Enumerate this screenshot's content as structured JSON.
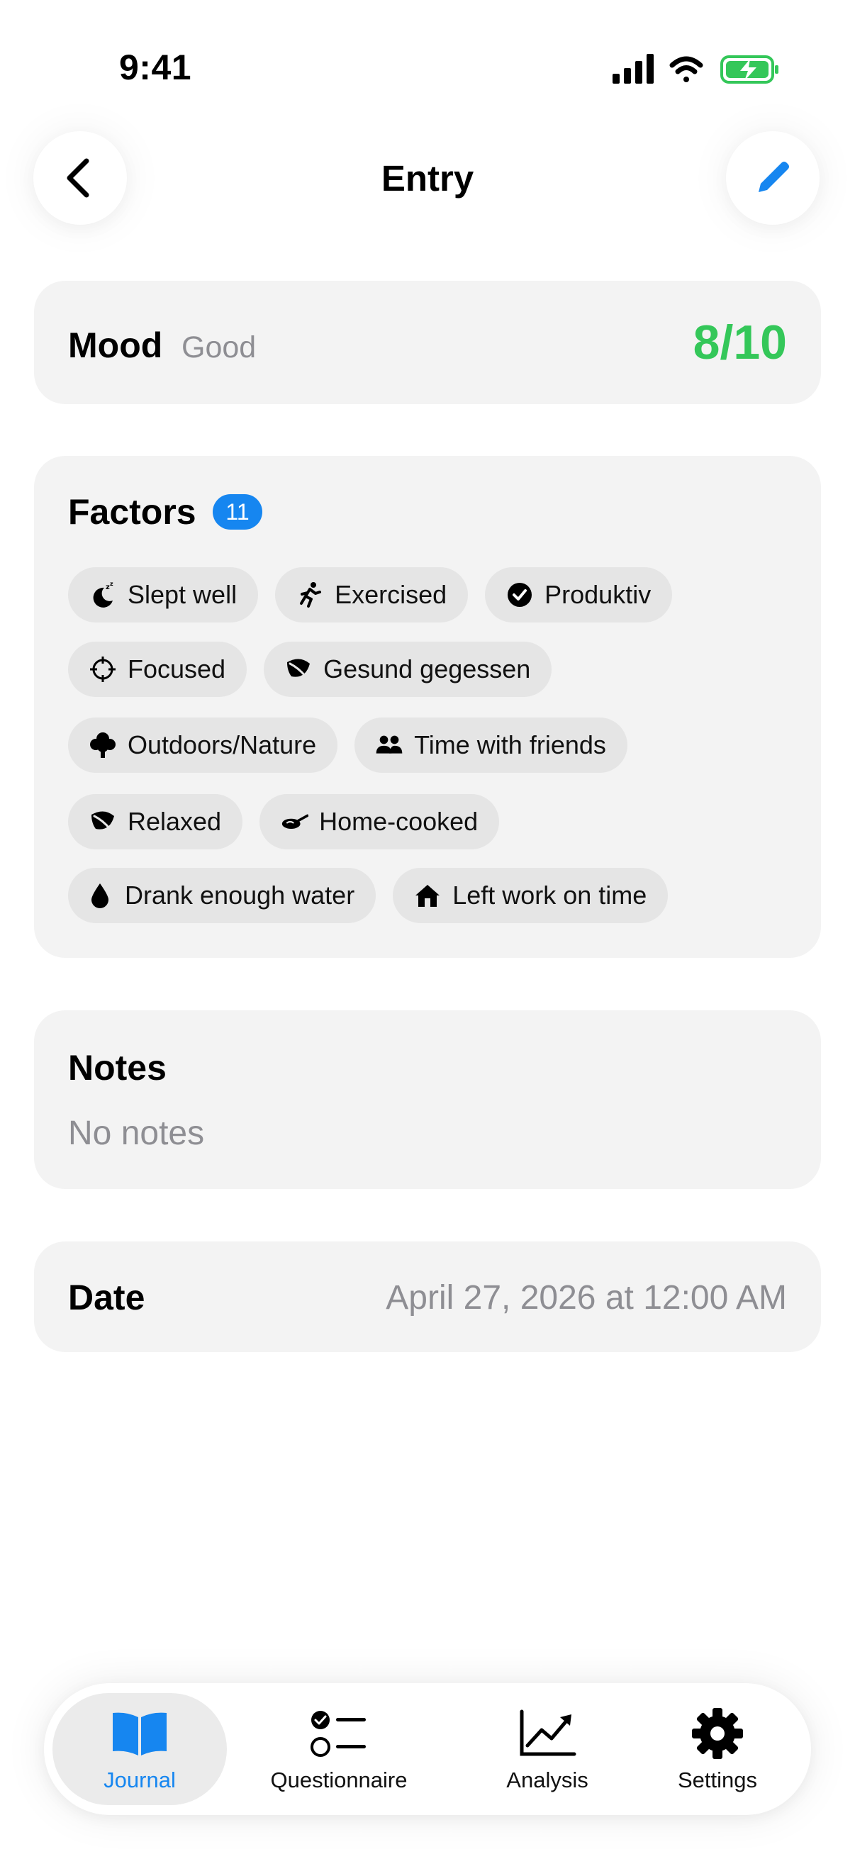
{
  "status_bar": {
    "time": "9:41"
  },
  "header": {
    "title": "Entry"
  },
  "mood": {
    "label": "Mood",
    "word": "Good",
    "score": "8/10"
  },
  "factors": {
    "title": "Factors",
    "count": "11",
    "chips": [
      {
        "label": "Slept well",
        "icon": "moon-zzz-icon"
      },
      {
        "label": "Exercised",
        "icon": "running-figure-icon"
      },
      {
        "label": "Produktiv",
        "icon": "checkmark-circle-icon"
      },
      {
        "label": "Focused",
        "icon": "scope-icon"
      },
      {
        "label": "Gesund gegessen",
        "icon": "leaf-icon"
      },
      {
        "label": "Outdoors/Nature",
        "icon": "tree-icon"
      },
      {
        "label": "Time with friends",
        "icon": "people-icon"
      },
      {
        "label": "Relaxed",
        "icon": "leaf-icon"
      },
      {
        "label": "Home-cooked",
        "icon": "frying-pan-icon"
      },
      {
        "label": "Drank enough water",
        "icon": "drop-icon"
      },
      {
        "label": "Left work on time",
        "icon": "house-icon"
      }
    ]
  },
  "notes": {
    "title": "Notes",
    "empty_text": "No notes"
  },
  "date": {
    "label": "Date",
    "value": "April 27, 2026 at 12:00 AM"
  },
  "tabbar": {
    "active": "Journal",
    "tabs": [
      {
        "label": "Journal",
        "icon": "book-icon"
      },
      {
        "label": "Questionnaire",
        "icon": "checklist-icon"
      },
      {
        "label": "Analysis",
        "icon": "chart-line-up-icon"
      },
      {
        "label": "Settings",
        "icon": "gear-icon"
      }
    ]
  },
  "colors": {
    "accent_blue": "#1686f0",
    "score_green": "#34c759",
    "card_bg": "#f3f3f3",
    "chip_bg": "#e5e5e5",
    "secondary_text": "#8e8e93"
  }
}
